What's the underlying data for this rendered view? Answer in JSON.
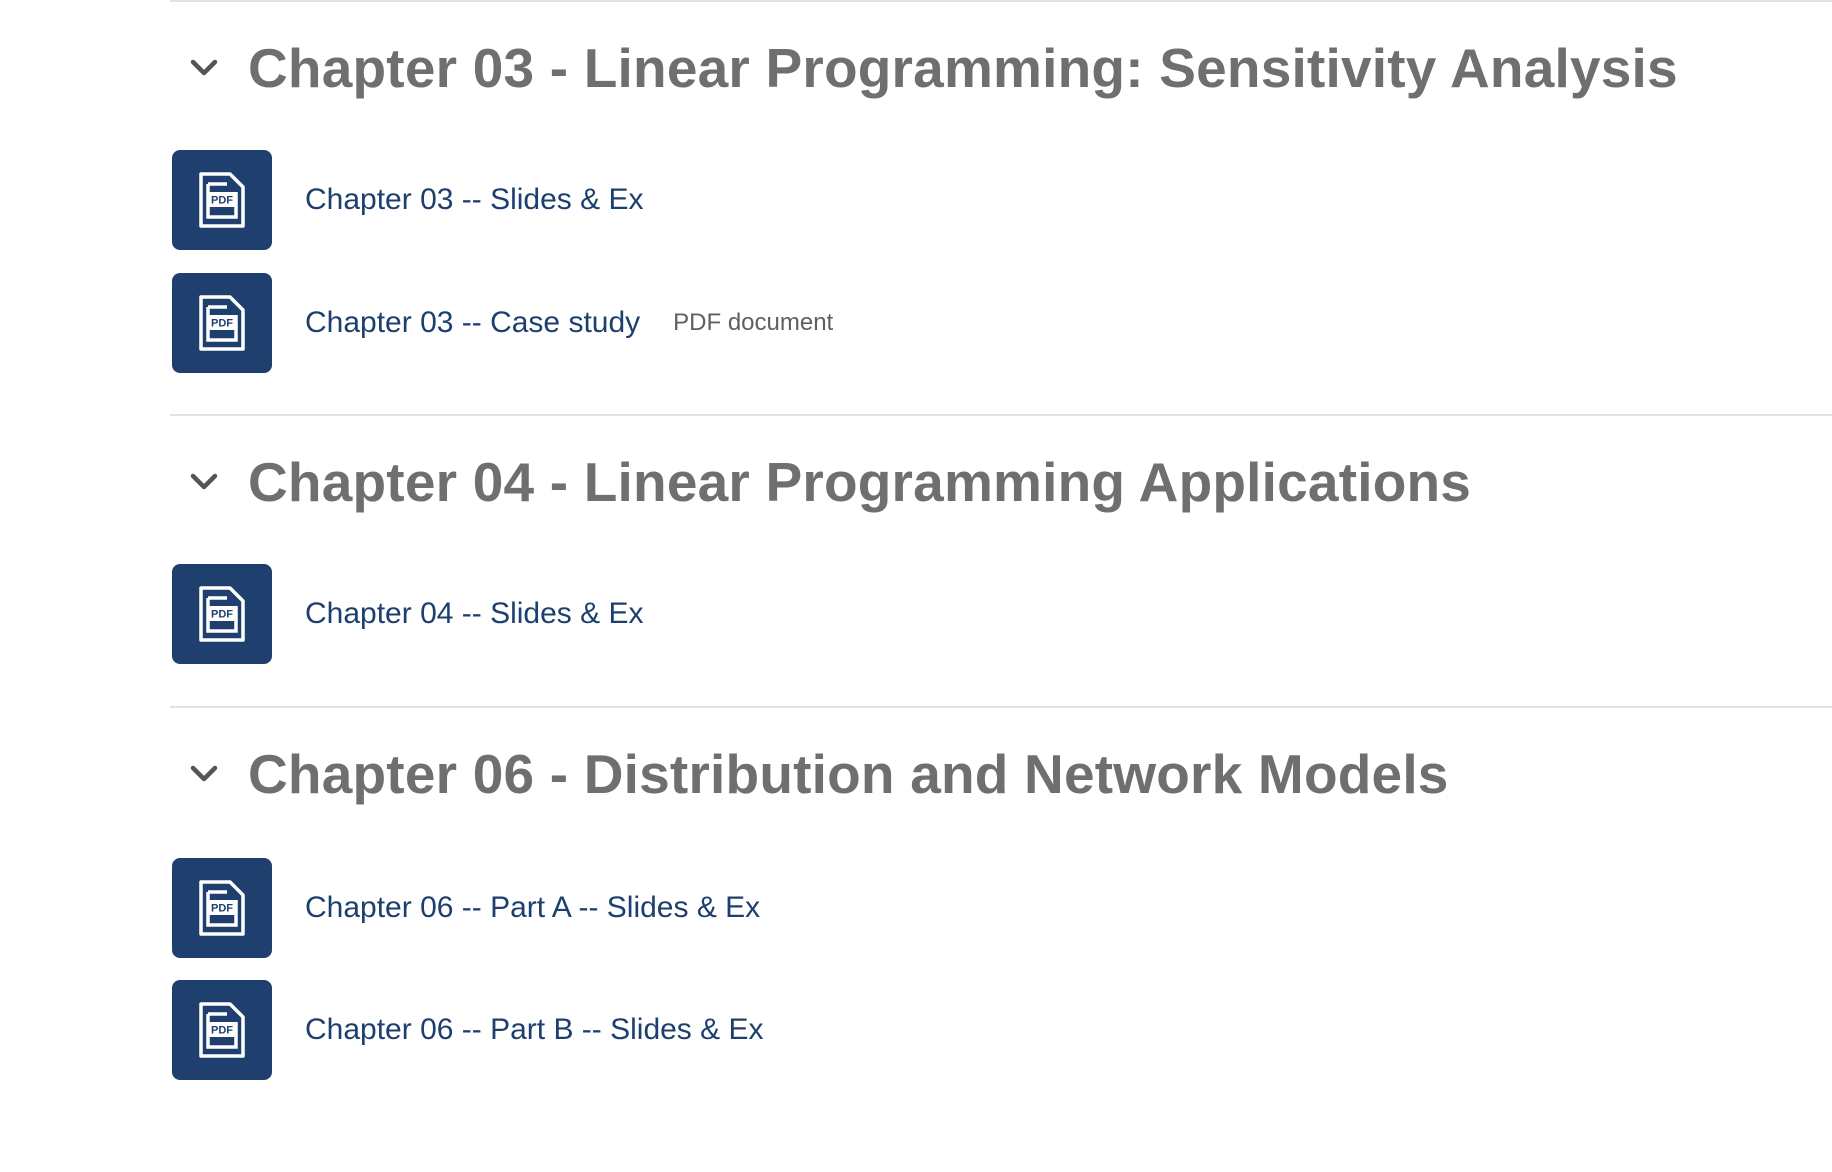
{
  "sections": [
    {
      "title": "Chapter 03 - Linear Programming: Sensitivity Analysis",
      "activities": [
        {
          "label": "Chapter 03 -- Slides & Ex",
          "meta": ""
        },
        {
          "label": "Chapter 03 -- Case study",
          "meta": "PDF document"
        }
      ]
    },
    {
      "title": "Chapter 04 - Linear Programming Applications",
      "activities": [
        {
          "label": "Chapter 04 -- Slides & Ex",
          "meta": ""
        }
      ]
    },
    {
      "title": "Chapter 06 - Distribution and Network Models",
      "activities": [
        {
          "label": "Chapter 06 -- Part A -- Slides & Ex",
          "meta": ""
        },
        {
          "label": "Chapter 06 -- Part B -- Slides & Ex",
          "meta": ""
        }
      ]
    }
  ],
  "icons": {
    "activity_icon": "pdf-file-icon",
    "collapse_icon": "chevron-down-icon"
  },
  "colors": {
    "icon_background": "#1f3f6e",
    "link": "#1d3f6e",
    "section_title": "#6f6f6f",
    "divider": "#dee2e6"
  }
}
